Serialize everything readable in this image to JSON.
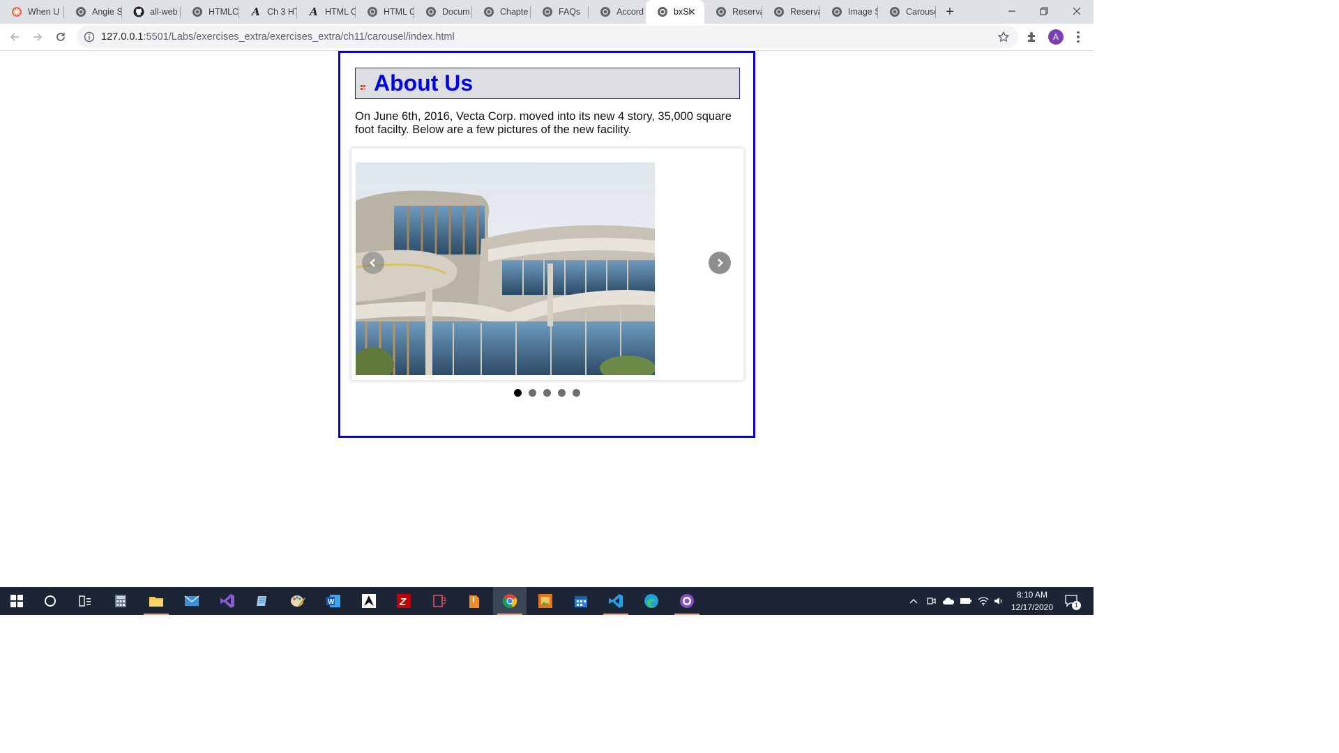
{
  "browser": {
    "tabs": [
      {
        "title": "When U",
        "icon": "flower-icon"
      },
      {
        "title": "Angie S",
        "icon": "globe-icon"
      },
      {
        "title": "all-web",
        "icon": "github-icon"
      },
      {
        "title": "HTMLC",
        "icon": "globe-icon"
      },
      {
        "title": "Ch 3 HT",
        "icon": "script-a-icon"
      },
      {
        "title": "HTML C",
        "icon": "script-a-icon"
      },
      {
        "title": "HTML C",
        "icon": "globe-icon"
      },
      {
        "title": "Docum",
        "icon": "globe-icon"
      },
      {
        "title": "Chapte",
        "icon": "globe-icon"
      },
      {
        "title": "FAQs",
        "icon": "globe-icon"
      },
      {
        "title": "Accord",
        "icon": "globe-icon"
      },
      {
        "title": "bxSl",
        "icon": "globe-icon",
        "active": true
      },
      {
        "title": "Reserva",
        "icon": "globe-icon"
      },
      {
        "title": "Reserva",
        "icon": "globe-icon"
      },
      {
        "title": "Image S",
        "icon": "globe-icon"
      },
      {
        "title": "Carouse",
        "icon": "globe-icon"
      }
    ],
    "address": {
      "host": "127.0.0.1",
      "rest": ":5501/Labs/exercises_extra/exercises_extra/ch11/carousel/index.html"
    },
    "profile_initial": "A"
  },
  "page": {
    "heading": "About Us",
    "intro": "On June 6th, 2016, Vecta Corp. moved into its new 4 story, 35,000 square foot facilty. Below are a few pictures of the new facility.",
    "slider": {
      "slide_count": 5,
      "active_slide": 1
    }
  },
  "taskbar": {
    "apps": [
      "windows-start-icon",
      "cortana-icon",
      "task-view-icon",
      "calculator-icon",
      "file-explorer-icon",
      "mail-icon",
      "visual-studio-icon",
      "notepad-icon",
      "paint-icon",
      "word-icon",
      "inkscape-icon",
      "filezilla-icon",
      "app-icon",
      "archive-icon",
      "chrome-icon",
      "image-app-icon",
      "calendar-icon",
      "vscode-icon",
      "edge-icon",
      "github-desktop-icon"
    ],
    "clock": {
      "time": "8:10 AM",
      "date": "12/17/2020"
    },
    "notification_count": "1"
  },
  "colors": {
    "heading_text": "#0000ee",
    "heading_bg": "#dcdee2",
    "page_border": "#0000ee",
    "taskbar_bg": "#1b2535",
    "tabstrip_bg": "#dee1e6"
  }
}
